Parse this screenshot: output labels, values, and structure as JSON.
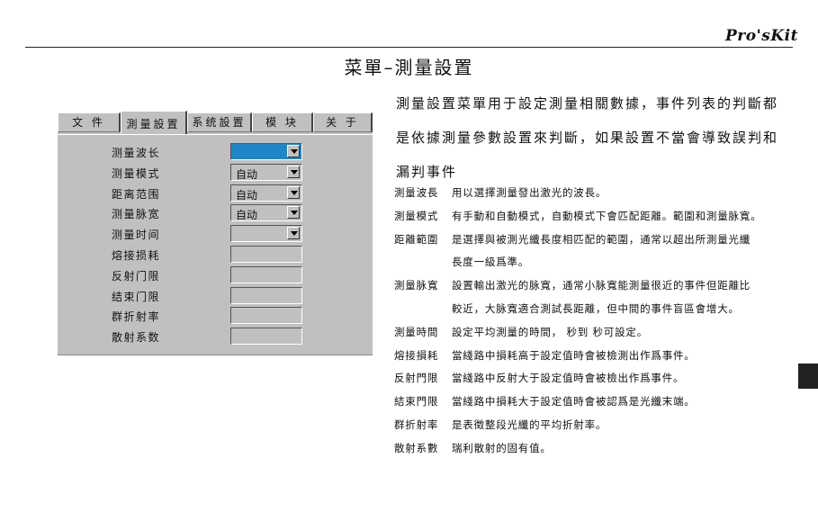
{
  "header": {
    "brand": "Pro'sKit",
    "title": "菜單–測量設置"
  },
  "tabs": [
    {
      "label": "文 件"
    },
    {
      "label": "測量設置"
    },
    {
      "label": "系统設置"
    },
    {
      "label": "模 块"
    },
    {
      "label": "关 于"
    }
  ],
  "active_tab": "測量設置",
  "form": {
    "rows": [
      {
        "label": "测量波长",
        "type": "select",
        "value": "",
        "highlight": "#1f86c8"
      },
      {
        "label": "测量模式",
        "type": "select",
        "value": "自动"
      },
      {
        "label": "距离范围",
        "type": "select",
        "value": "自动"
      },
      {
        "label": "测量脉宽",
        "type": "select",
        "value": "自动"
      },
      {
        "label": "测量时间",
        "type": "select",
        "value": ""
      },
      {
        "label": "熔接损耗",
        "type": "input",
        "value": ""
      },
      {
        "label": "反射门限",
        "type": "input",
        "value": ""
      },
      {
        "label": "结束门限",
        "type": "input",
        "value": ""
      },
      {
        "label": "群折射率",
        "type": "input",
        "value": ""
      },
      {
        "label": "散射系数",
        "type": "input",
        "value": ""
      }
    ]
  },
  "description": {
    "intro_lines": [
      "測量設置菜單用于設定測量相關數據，事件列表的判斷都",
      "是依據測量參數設置來判斷，如果設置不當會導致誤判和",
      "漏判事件"
    ],
    "items": [
      {
        "term": "測量波長",
        "lines": [
          "用以選擇測量發出激光的波長。"
        ]
      },
      {
        "term": "測量模式",
        "lines": [
          "有手動和自動模式，自動模式下會匹配距離。範圍和測量脉寬。"
        ]
      },
      {
        "term": "距離範圍",
        "lines": [
          "是選擇與被測光纖長度相匹配的範圍，通常以超出所測量光纖",
          "長度一級爲準。"
        ]
      },
      {
        "term": "測量脉寬",
        "lines": [
          "設置輸出激光的脉寬，通常小脉寬能測量很近的事件但距離比",
          "較近，大脉寬適合測試長距離，但中間的事件盲區會增大。"
        ]
      },
      {
        "term": "測量時間",
        "lines": [
          "設定平均測量的時間，  秒到    秒可設定。"
        ]
      },
      {
        "term": "熔接損耗",
        "lines": [
          "當綫路中損耗高于設定值時會被檢測出作爲事件。"
        ]
      },
      {
        "term": "反射門限",
        "lines": [
          "當綫路中反射大于設定值時會被檢出作爲事件。"
        ]
      },
      {
        "term": "結束門限",
        "lines": [
          "當綫路中損耗大于設定值時會被認爲是光纖末端。"
        ]
      },
      {
        "term": "群折射率",
        "lines": [
          "是表徵整段光纖的平均折射率。"
        ]
      },
      {
        "term": "散射系數",
        "lines": [
          "瑞利散射的固有值。"
        ]
      }
    ]
  }
}
